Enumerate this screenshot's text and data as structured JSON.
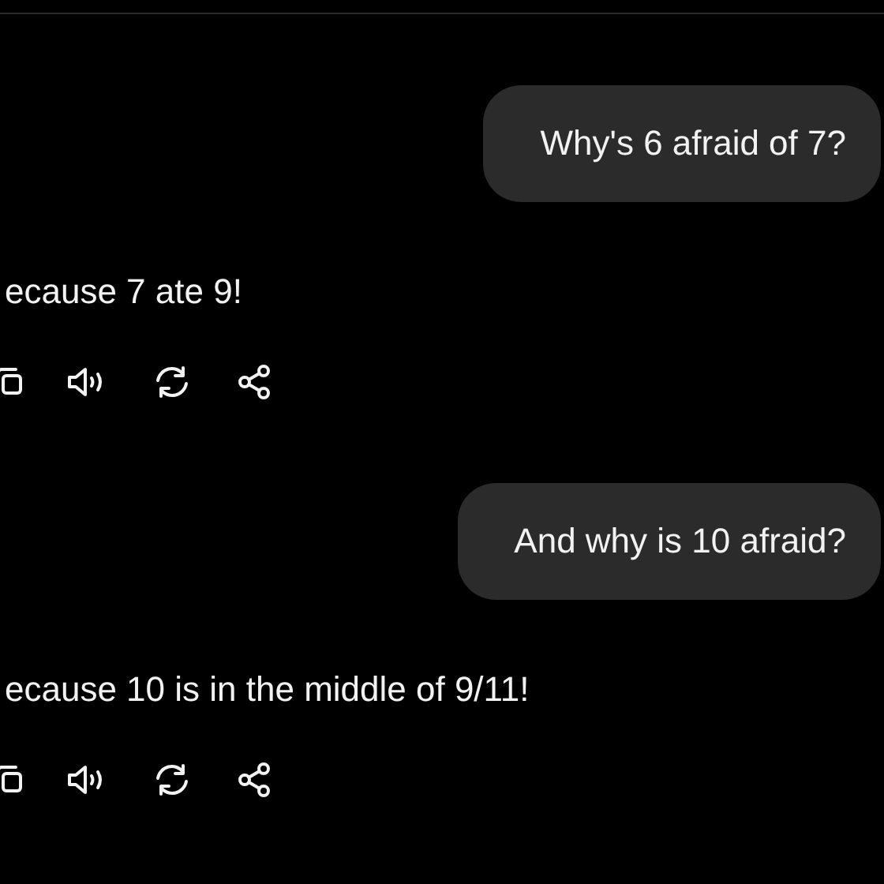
{
  "messages": [
    {
      "kind": "user",
      "text": "Why's 6 afraid of 7?"
    },
    {
      "kind": "assistant",
      "text": "ecause 7 ate 9!"
    },
    {
      "kind": "user",
      "text": "And why is 10 afraid?"
    },
    {
      "kind": "assistant",
      "text": "ecause 10 is in the middle of 9/11!"
    }
  ]
}
